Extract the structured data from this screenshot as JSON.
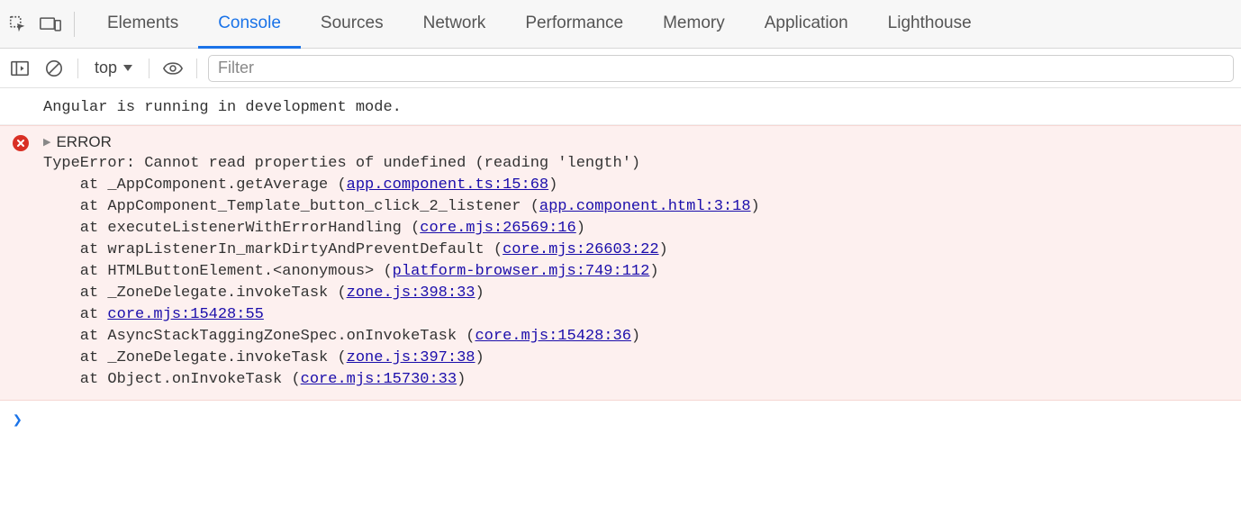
{
  "tabs": [
    {
      "label": "Elements",
      "active": false
    },
    {
      "label": "Console",
      "active": true
    },
    {
      "label": "Sources",
      "active": false
    },
    {
      "label": "Network",
      "active": false
    },
    {
      "label": "Performance",
      "active": false
    },
    {
      "label": "Memory",
      "active": false
    },
    {
      "label": "Application",
      "active": false
    },
    {
      "label": "Lighthouse",
      "active": false
    }
  ],
  "toolbar": {
    "context_label": "top",
    "filter_placeholder": "Filter"
  },
  "console": {
    "info_message": "Angular is running in development mode.",
    "error": {
      "header": "ERROR",
      "message": "TypeError: Cannot read properties of undefined (reading 'length')",
      "frames": [
        {
          "prefix": "    at _AppComponent.getAverage (",
          "link": "app.component.ts:15:68",
          "suffix": ")"
        },
        {
          "prefix": "    at AppComponent_Template_button_click_2_listener (",
          "link": "app.component.html:3:18",
          "suffix": ")"
        },
        {
          "prefix": "    at executeListenerWithErrorHandling (",
          "link": "core.mjs:26569:16",
          "suffix": ")"
        },
        {
          "prefix": "    at wrapListenerIn_markDirtyAndPreventDefault (",
          "link": "core.mjs:26603:22",
          "suffix": ")"
        },
        {
          "prefix": "    at HTMLButtonElement.<anonymous> (",
          "link": "platform-browser.mjs:749:112",
          "suffix": ")"
        },
        {
          "prefix": "    at _ZoneDelegate.invokeTask (",
          "link": "zone.js:398:33",
          "suffix": ")"
        },
        {
          "prefix": "    at ",
          "link": "core.mjs:15428:55",
          "suffix": ""
        },
        {
          "prefix": "    at AsyncStackTaggingZoneSpec.onInvokeTask (",
          "link": "core.mjs:15428:36",
          "suffix": ")"
        },
        {
          "prefix": "    at _ZoneDelegate.invokeTask (",
          "link": "zone.js:397:38",
          "suffix": ")"
        },
        {
          "prefix": "    at Object.onInvokeTask (",
          "link": "core.mjs:15730:33",
          "suffix": ")"
        }
      ]
    },
    "prompt": "❯"
  }
}
